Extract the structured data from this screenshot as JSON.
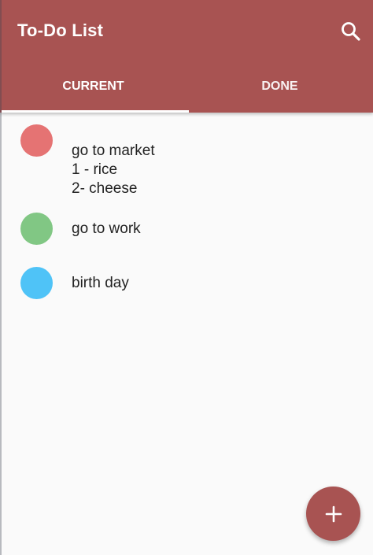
{
  "app": {
    "title": "To-Do List",
    "accent_color": "#a85352"
  },
  "header": {
    "search_icon": "search-icon"
  },
  "tabs": [
    {
      "label": "CURRENT",
      "selected": true
    },
    {
      "label": "DONE",
      "selected": false
    }
  ],
  "todos": [
    {
      "text": "go to market\n1 - rice\n2- cheese",
      "color": "#e57373"
    },
    {
      "text": "go to work",
      "color": "#81c784"
    },
    {
      "text": "birth day",
      "color": "#4fc3f7"
    }
  ],
  "fab": {
    "icon": "plus-icon"
  }
}
